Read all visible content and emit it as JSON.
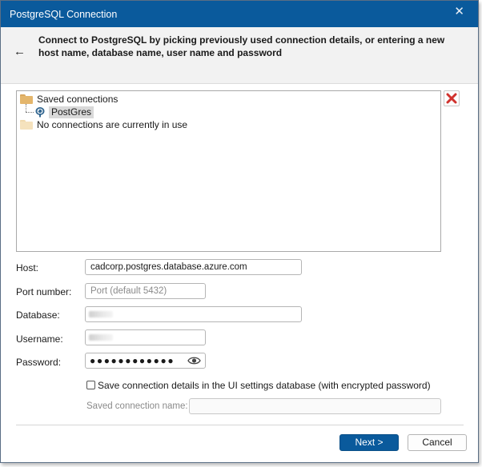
{
  "window": {
    "title": "PostgreSQL Connection",
    "close_glyph": "✕"
  },
  "header": {
    "back_glyph": "←",
    "description": "Connect to PostgreSQL by picking previously used connection details, or entering a new host name, database name, user name and password"
  },
  "tree": {
    "saved_connections_label": "Saved connections",
    "saved_items": [
      {
        "label": "PostGres",
        "icon": "postgres-elephant-icon"
      }
    ],
    "in_use_label": "No connections are currently in use"
  },
  "form": {
    "host_label": "Host:",
    "host_value": "cadcorp.postgres.database.azure.com",
    "port_label": "Port number:",
    "port_placeholder": "Port (default 5432)",
    "database_label": "Database:",
    "username_label": "Username:",
    "password_label": "Password:",
    "password_mask": "●●●●●●●●●●●●",
    "save_checkbox_label": "Save connection details in the UI settings database (with encrypted password)",
    "saved_name_label": "Saved connection name:"
  },
  "buttons": {
    "next": "Next >",
    "cancel": "Cancel"
  },
  "colors": {
    "titlebar": "#0a5a9c",
    "primary_button": "#0a5a9c",
    "delete_red": "#d0312d"
  }
}
